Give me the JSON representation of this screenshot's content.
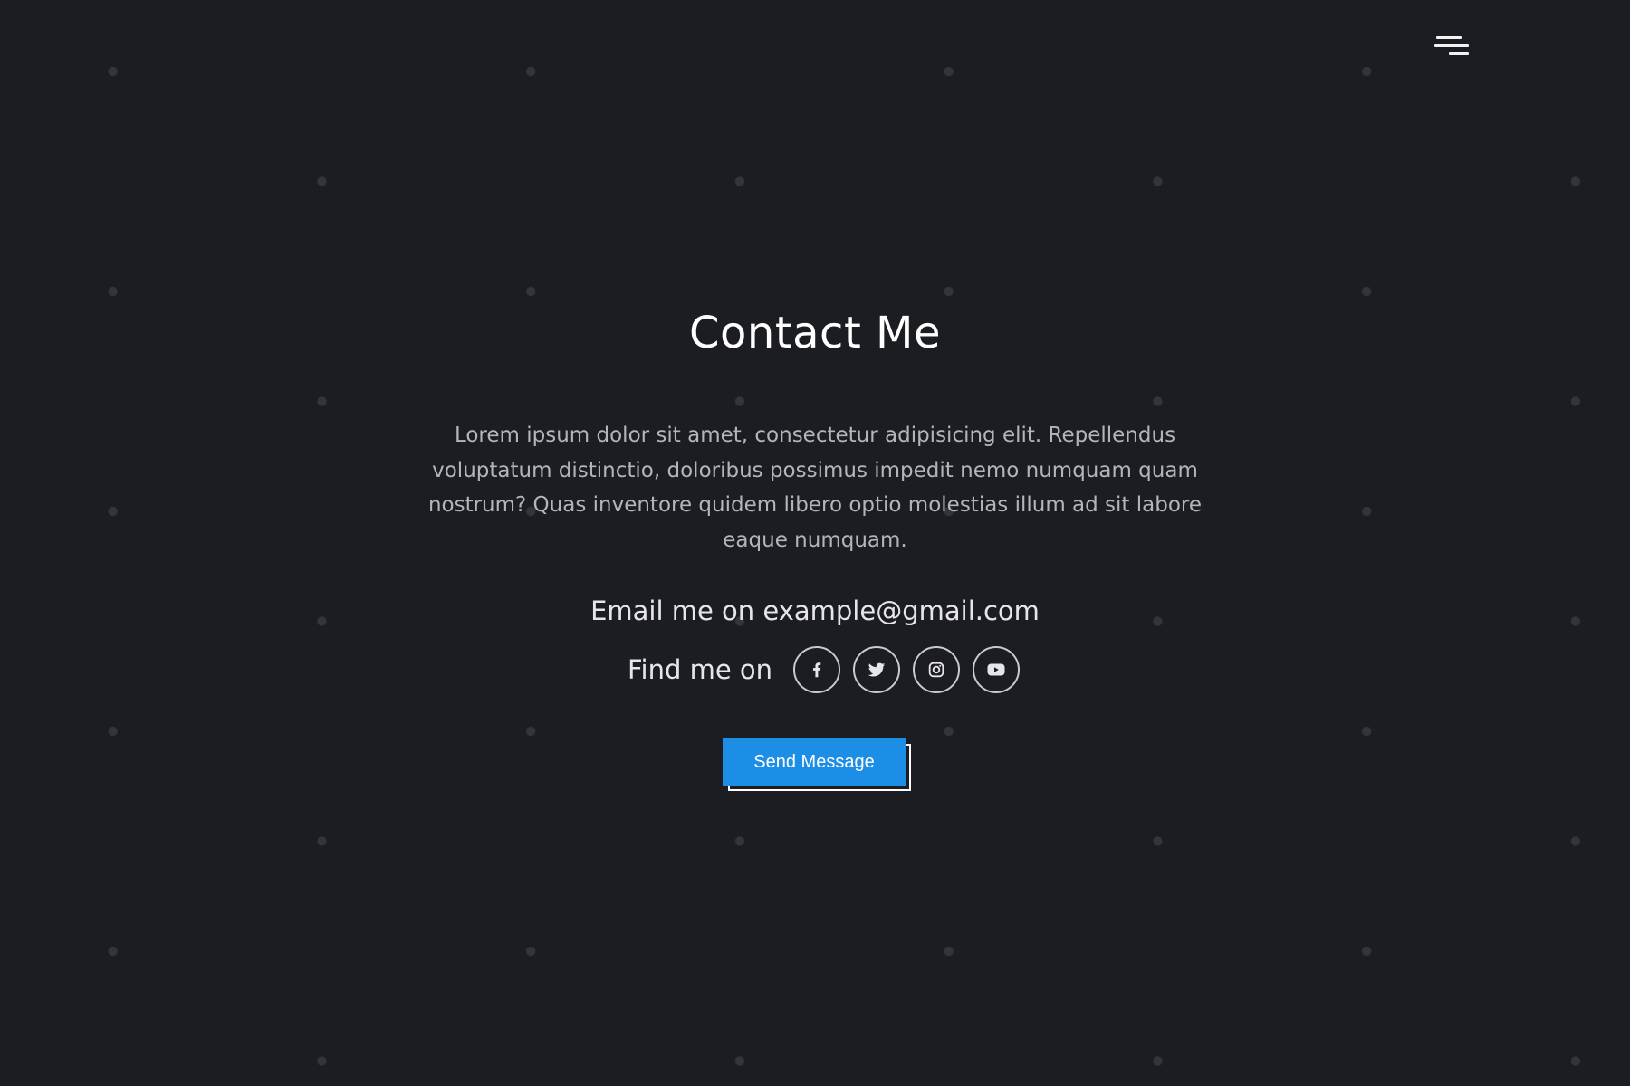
{
  "header": {
    "menu_icon": "hamburger-menu-icon"
  },
  "contact": {
    "title": "Contact Me",
    "description": "Lorem ipsum dolor sit amet, consectetur adipisicing elit. Repellendus voluptatum distinctio, doloribus possimus impedit nemo numquam quam nostrum? Quas inventore quidem libero optio molestias illum ad sit labore eaque numquam.",
    "email_line": "Email me on example@gmail.com",
    "find_label": "Find me on",
    "social_icons": [
      "facebook-icon",
      "twitter-icon",
      "instagram-icon",
      "youtube-icon"
    ],
    "send_button_label": "Send Message"
  },
  "colors": {
    "background": "#1c1d22",
    "dots": "#33353c",
    "accent": "#1d8ee6",
    "text": "#ffffff",
    "muted_text": "#b4b5ba"
  }
}
